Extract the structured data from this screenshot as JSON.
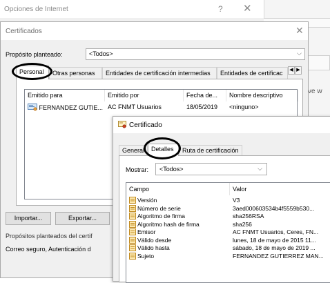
{
  "background_window": {
    "title": "Opciones de Internet",
    "help_glyph": "?",
    "close_glyph": "✕",
    "right_fragment": "ve w"
  },
  "certificates_dialog": {
    "title": "Certificados",
    "close_glyph": "✕",
    "purpose_label": "Propósito planteado:",
    "purpose_value": "<Todos>",
    "tabs": [
      {
        "label": "Personal",
        "active": true
      },
      {
        "label": "Otras personas"
      },
      {
        "label": "Entidades de certificación intermedias"
      },
      {
        "label": "Entidades de certificac"
      }
    ],
    "columns": [
      "Emitido para",
      "Emitido por",
      "Fecha de...",
      "Nombre descriptivo"
    ],
    "rows": [
      {
        "issued_to": "FERNANDEZ GUTIE...",
        "issued_by": "AC FNMT Usuarios",
        "date": "18/05/2019",
        "friendly_name": "<ninguno>"
      }
    ],
    "buttons": {
      "import": "Importar...",
      "export": "Exportar..."
    },
    "purposes_label": "Propósitos planteados del certif",
    "purposes_value": "Correo seguro, Autenticación d"
  },
  "certificate_dialog": {
    "title": "Certificado",
    "tabs": [
      {
        "label": "General"
      },
      {
        "label": "Detalles",
        "active": true
      },
      {
        "label": "Ruta de certificación"
      }
    ],
    "show_label": "Mostrar:",
    "show_value": "<Todos>",
    "columns": [
      "Campo",
      "Valor"
    ],
    "fields": [
      {
        "field": "Versión",
        "value": "V3"
      },
      {
        "field": "Número de serie",
        "value": "3aed000603534b4f5559b530..."
      },
      {
        "field": "Algoritmo de firma",
        "value": "sha256RSA"
      },
      {
        "field": "Algoritmo hash de firma",
        "value": "sha256"
      },
      {
        "field": "Emisor",
        "value": "AC FNMT Usuarios, Ceres, FN..."
      },
      {
        "field": "Válido desde",
        "value": "lunes, 18 de mayo de 2015 11..."
      },
      {
        "field": "Válido hasta",
        "value": "sábado, 18 de mayo de 2019 ..."
      },
      {
        "field": "Sujeto",
        "value": "FERNANDEZ GUTIERREZ MAN..."
      }
    ]
  },
  "colors": {
    "highlight": "#000000",
    "window_bg": "#f0f0f0",
    "border": "#adadad"
  }
}
